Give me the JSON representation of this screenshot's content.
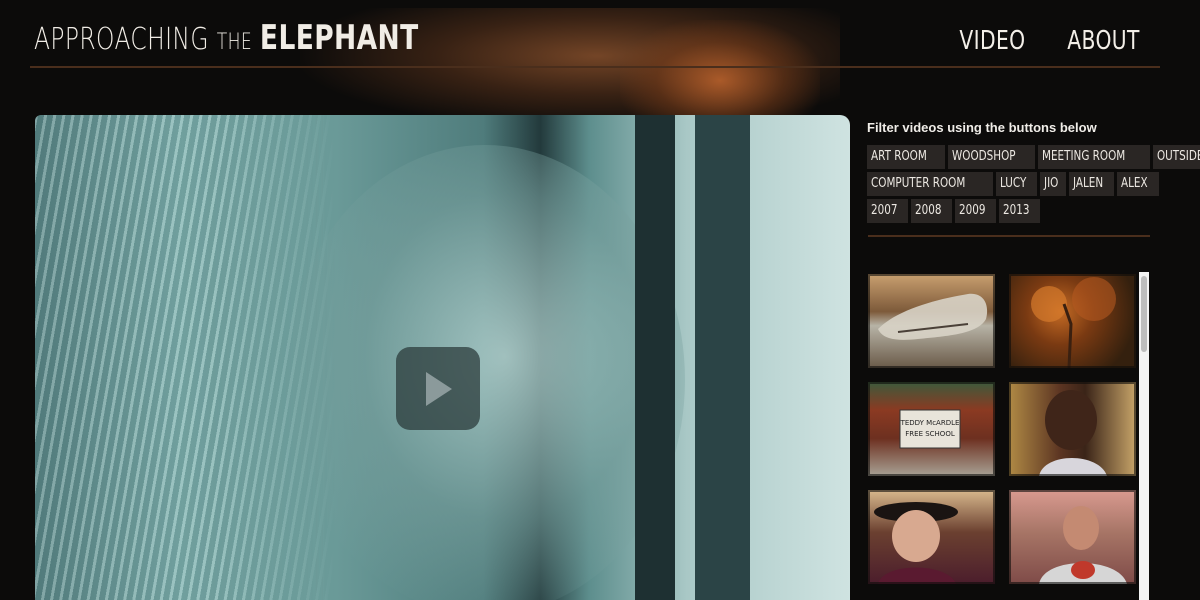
{
  "header": {
    "logo": {
      "part1": "APPROACHING",
      "part2": "THE",
      "part3": "ELEPHANT"
    },
    "nav": [
      {
        "label": "VIDEO"
      },
      {
        "label": "ABOUT"
      }
    ]
  },
  "filter": {
    "title": "Filter videos using the buttons below",
    "rows": [
      [
        "ART ROOM",
        "WOODSHOP",
        "MEETING ROOM",
        "OUTSIDE"
      ],
      [
        "COMPUTER ROOM",
        "LUCY",
        "JIO",
        "JALEN",
        "ALEX"
      ],
      [
        "2007",
        "2008",
        "2009",
        "2013"
      ]
    ]
  },
  "video": {
    "play_icon": "play-icon"
  },
  "thumbnails": [
    {
      "icon": "animal-skull-thumbnail"
    },
    {
      "icon": "autumn-tree-thumbnail"
    },
    {
      "icon": "school-sign-thumbnail"
    },
    {
      "icon": "boy-portrait-thumbnail"
    },
    {
      "icon": "girl-hat-thumbnail"
    },
    {
      "icon": "man-shirt-thumbnail"
    }
  ],
  "thumbnail_sign": {
    "line1": "TEDDY McARDLE",
    "line2": "FREE SCHOOL"
  },
  "colors": {
    "background": "#0c0b0a",
    "accent_line": "#4a2e1c",
    "tag_bg": "#2a2624",
    "video_tint": "#6d9d9b"
  }
}
